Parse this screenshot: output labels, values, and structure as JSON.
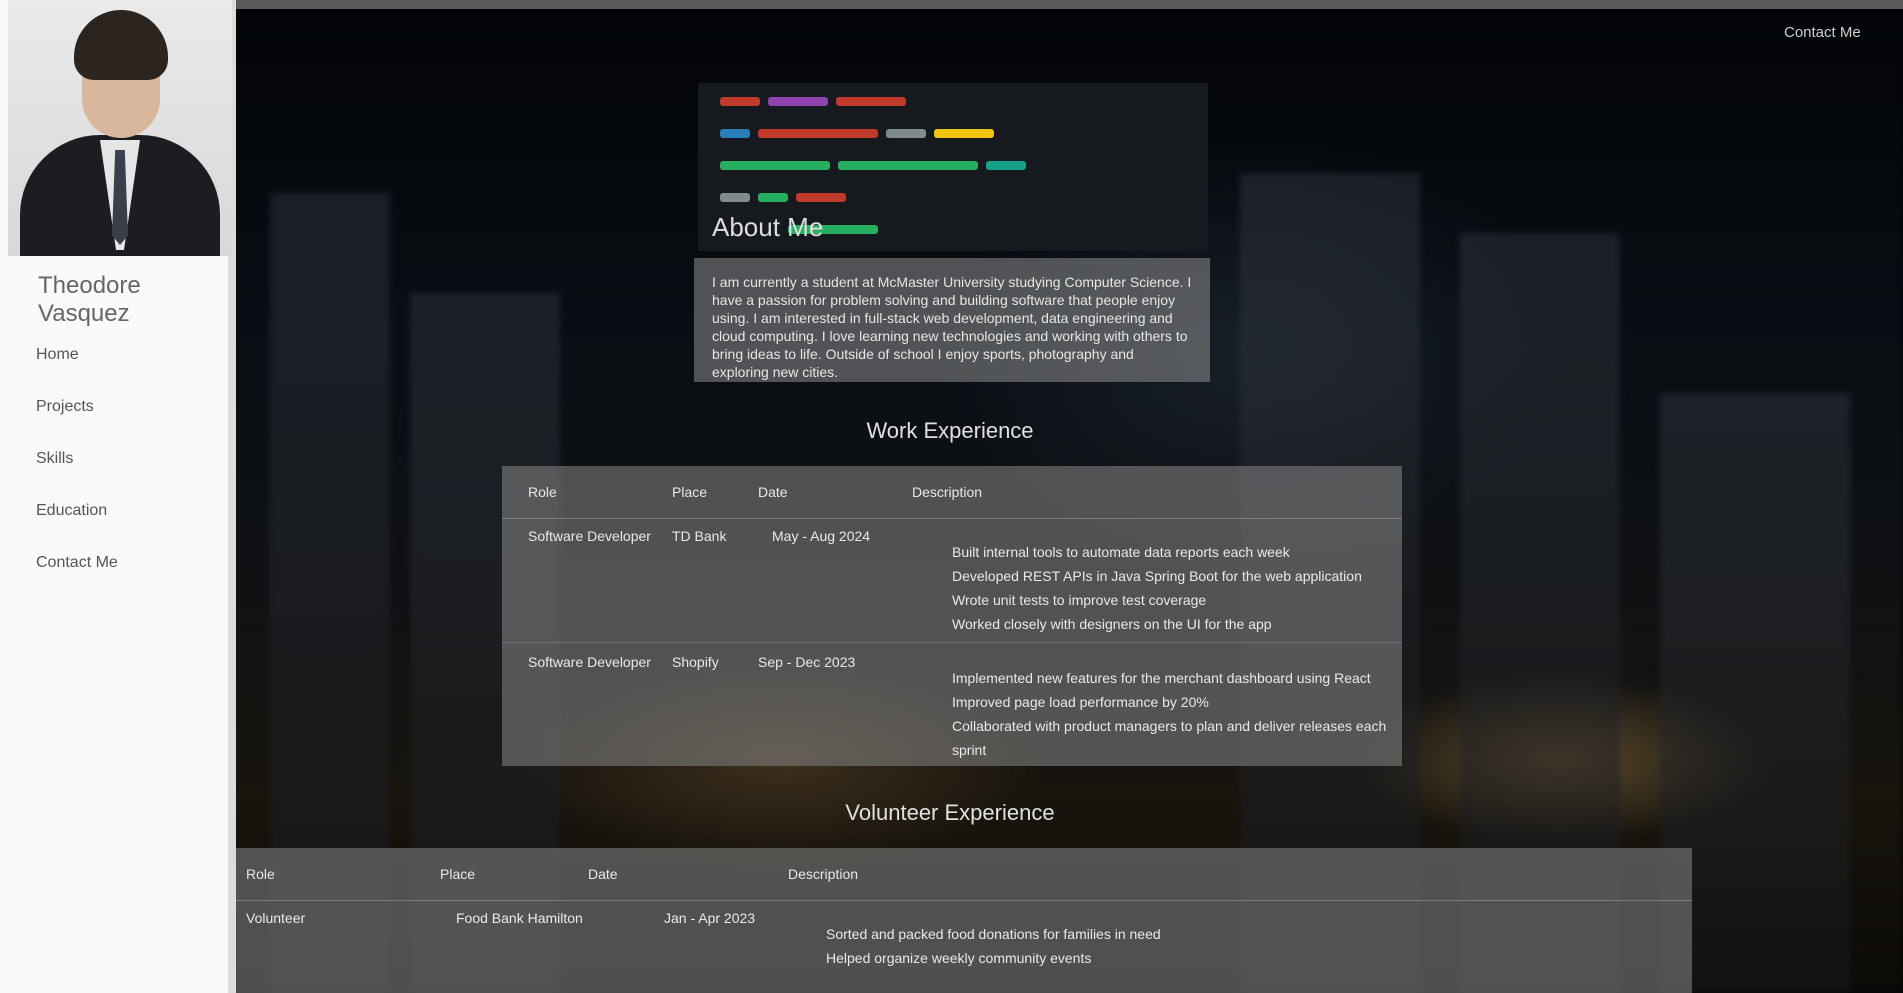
{
  "owner": {
    "name": "Theodore Vasquez"
  },
  "nav": {
    "items": [
      "Home",
      "Projects",
      "Skills",
      "Education",
      "Contact Me"
    ]
  },
  "header": {
    "contact_label": "Contact Me"
  },
  "about": {
    "heading": "About Me",
    "text": "I am currently a student at McMaster University studying Computer Science. I have a passion for problem solving and building software that people enjoy using. I am interested in full-stack web development, data engineering and cloud computing. I love learning new technologies and working with others to bring ideas to life. Outside of school I enjoy sports, photography and exploring new cities."
  },
  "work": {
    "heading": "Work Experience",
    "columns": [
      "Role",
      "Place",
      "Date",
      "Description"
    ],
    "rows": [
      {
        "role": "Software Developer",
        "place": "TD Bank",
        "date": "May - Aug 2024",
        "bullets": [
          "Built internal tools to automate data reports each week",
          "Developed REST APIs in Java Spring Boot for the web application",
          "Wrote unit tests to improve test coverage",
          "Worked closely with designers on the UI for the app"
        ]
      },
      {
        "role": "Software Developer",
        "place": "Shopify",
        "date": "Sep - Dec 2023",
        "bullets": [
          "Implemented new features for the merchant dashboard using React",
          "Improved page load performance by 20%",
          "Collaborated with product managers to plan and deliver releases each sprint"
        ]
      }
    ]
  },
  "volunteer": {
    "heading": "Volunteer Experience",
    "columns": [
      "Role",
      "Place",
      "Date",
      "Description"
    ],
    "rows": [
      {
        "role": "Volunteer",
        "place": "Food Bank Hamilton",
        "date": "Jan - Apr 2023",
        "bullets": [
          "Sorted and packed food donations for families in need",
          "Helped organize weekly community events"
        ]
      }
    ]
  },
  "colors": {
    "sidebar_bg": "#fafafa",
    "card_bg": "#8c8c8c",
    "page_bg": "#05070c"
  }
}
